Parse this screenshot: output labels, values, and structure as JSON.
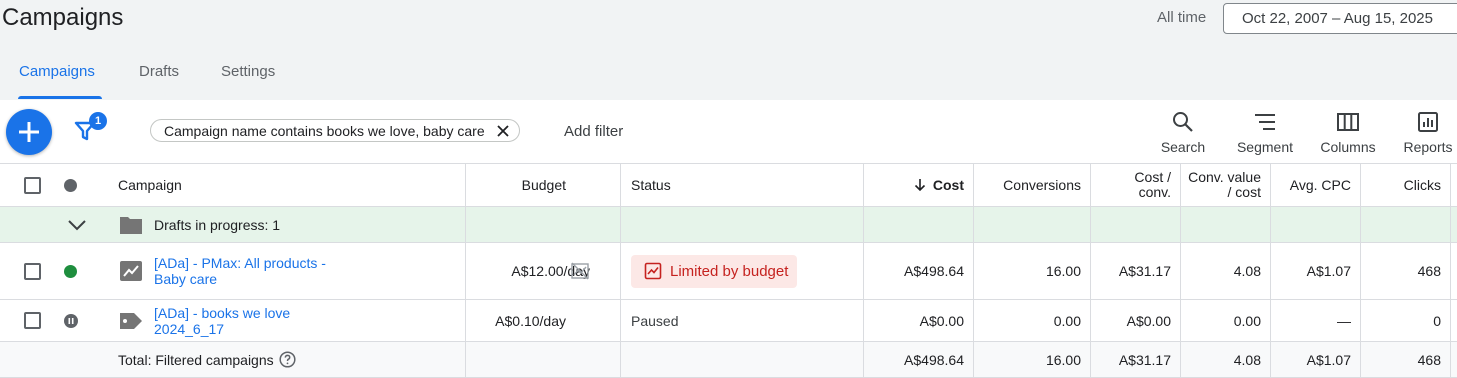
{
  "page": {
    "title": "Campaigns",
    "range_label": "All time",
    "date_range": "Oct 22, 2007 – Aug 15, 2025"
  },
  "tabs": [
    {
      "label": "Campaigns",
      "active": true
    },
    {
      "label": "Drafts",
      "active": false
    },
    {
      "label": "Settings",
      "active": false
    }
  ],
  "toolbar": {
    "filter_count": "1",
    "filter_chip": "Campaign name contains books we love, baby care",
    "add_filter": "Add filter",
    "tools": [
      {
        "label": "Search",
        "icon": "search-icon"
      },
      {
        "label": "Segment",
        "icon": "segment-icon"
      },
      {
        "label": "Columns",
        "icon": "columns-icon"
      },
      {
        "label": "Reports",
        "icon": "reports-icon"
      }
    ]
  },
  "table": {
    "headers": {
      "campaign": "Campaign",
      "budget": "Budget",
      "status": "Status",
      "cost": "Cost",
      "conversions": "Conversions",
      "cost_conv_1": "Cost /",
      "cost_conv_2": "conv.",
      "conv_value_1": "Conv. value",
      "conv_value_2": "/ cost",
      "avg_cpc": "Avg. CPC",
      "clicks": "Clicks"
    },
    "drafts_label": "Drafts in progress: 1",
    "rows": [
      {
        "name_1": "[ADa] - PMax: All products -",
        "name_2": "Baby care",
        "status_dot": "#1e8e3e",
        "type_icon": "chart-icon",
        "budget": "A$12.00/day",
        "status": "Limited by budget",
        "cost": "A$498.64",
        "conversions": "16.00",
        "cost_conv": "A$31.17",
        "conv_value_cost": "4.08",
        "avg_cpc": "A$1.07",
        "clicks": "468"
      },
      {
        "name_1": "[ADa] - books we love",
        "name_2": "2024_6_17",
        "status_dot": "#5f6368",
        "type_icon": "tag-icon",
        "budget": "A$0.10/day",
        "status": "Paused",
        "cost": "A$0.00",
        "conversions": "0.00",
        "cost_conv": "A$0.00",
        "conv_value_cost": "0.00",
        "avg_cpc": "—",
        "clicks": "0"
      }
    ],
    "total": {
      "label": "Total: Filtered campaigns",
      "cost": "A$498.64",
      "conversions": "16.00",
      "cost_conv": "A$31.17",
      "conv_value_cost": "4.08",
      "avg_cpc": "A$1.07",
      "clicks": "468"
    }
  },
  "colors": {
    "accent": "#1a73e8",
    "limited_bg": "#fce8e6",
    "limited_text": "#c5221f",
    "drafts_bg": "#e6f4ea"
  }
}
